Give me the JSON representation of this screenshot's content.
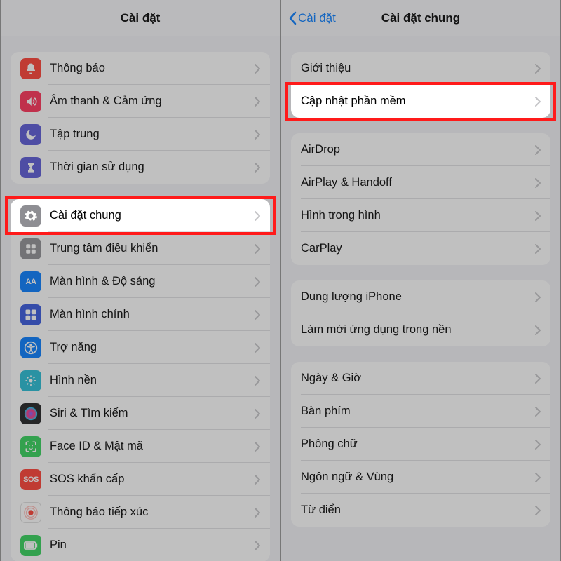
{
  "left": {
    "title": "Cài đặt",
    "groups": [
      {
        "rows": [
          {
            "label": "Thông báo",
            "icon": "bell-icon",
            "bg": "#ff3b30"
          },
          {
            "label": "Âm thanh & Cảm ứng",
            "icon": "sound-icon",
            "bg": "#ff2d55"
          },
          {
            "label": "Tập trung",
            "icon": "moon-icon",
            "bg": "#5856d6"
          },
          {
            "label": "Thời gian sử dụng",
            "icon": "hourglass-icon",
            "bg": "#5856d6"
          }
        ]
      },
      {
        "rows": [
          {
            "label": "Cài đặt chung",
            "icon": "gear-icon",
            "bg": "#8e8e93",
            "highlight": true
          },
          {
            "label": "Trung tâm điều khiển",
            "icon": "control-center-icon",
            "bg": "#8e8e93"
          },
          {
            "label": "Màn hình & Độ sáng",
            "icon": "display-icon",
            "bg": "#007aff",
            "text": "AA"
          },
          {
            "label": "Màn hình chính",
            "icon": "home-screen-icon",
            "bg": "#3355dd"
          },
          {
            "label": "Trợ năng",
            "icon": "accessibility-icon",
            "bg": "#007aff"
          },
          {
            "label": "Hình nền",
            "icon": "wallpaper-icon",
            "bg": "#22bcd4"
          },
          {
            "label": "Siri & Tìm kiếm",
            "icon": "siri-icon",
            "bg": "#1c1c1e"
          },
          {
            "label": "Face ID & Mật mã",
            "icon": "faceid-icon",
            "bg": "#30d158"
          },
          {
            "label": "SOS khẩn cấp",
            "icon": "sos-icon",
            "bg": "#ff3b30",
            "text": "SOS"
          },
          {
            "label": "Thông báo tiếp xúc",
            "icon": "exposure-icon",
            "bg": "#ffffff",
            "fg": "#ff3b30"
          },
          {
            "label": "Pin",
            "icon": "battery-icon",
            "bg": "#30d158"
          }
        ]
      }
    ]
  },
  "right": {
    "title": "Cài đặt chung",
    "back": "Cài đặt",
    "groups": [
      {
        "rows": [
          {
            "label": "Giới thiệu"
          },
          {
            "label": "Cập nhật phần mềm",
            "highlight": true
          }
        ]
      },
      {
        "rows": [
          {
            "label": "AirDrop"
          },
          {
            "label": "AirPlay & Handoff"
          },
          {
            "label": "Hình trong hình"
          },
          {
            "label": "CarPlay"
          }
        ]
      },
      {
        "rows": [
          {
            "label": "Dung lượng iPhone"
          },
          {
            "label": "Làm mới ứng dụng trong nền"
          }
        ]
      },
      {
        "rows": [
          {
            "label": "Ngày & Giờ"
          },
          {
            "label": "Bàn phím"
          },
          {
            "label": "Phông chữ"
          },
          {
            "label": "Ngôn ngữ & Vùng"
          },
          {
            "label": "Từ điển"
          }
        ]
      }
    ]
  }
}
